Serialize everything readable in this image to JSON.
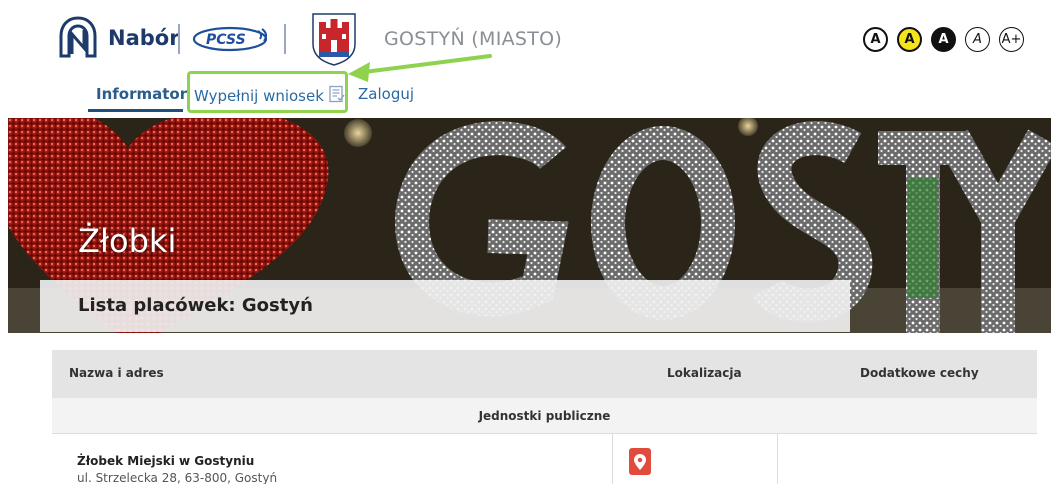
{
  "header": {
    "brand": "Nabór",
    "city": "GOSTYŃ (MIASTO)",
    "accessibility": [
      "A",
      "A",
      "A",
      "A",
      "A+"
    ]
  },
  "nav": {
    "items": [
      {
        "label": "Informator",
        "active": true
      },
      {
        "label": "Wypełnij wniosek",
        "icon": "form-document-icon"
      },
      {
        "label": "Zaloguj"
      }
    ]
  },
  "hero": {
    "title": "Żłobki",
    "subtitle": "Lista placówek: Gostyń"
  },
  "table": {
    "headers": {
      "name": "Nazwa i adres",
      "location": "Lokalizacja",
      "features": "Dodatkowe cechy"
    },
    "group": "Jednostki publiczne",
    "rows": [
      {
        "name": "Żłobek Miejski w Gostyniu",
        "address": "ul. Strzelecka 28, 63-800, Gostyń",
        "location_icon": "map-pin-icon"
      }
    ]
  },
  "colors": {
    "brand_navy": "#1e3a6b",
    "link_blue": "#2a6aa3",
    "highlight_green": "#8ed24e",
    "pin_red": "#e04b3c",
    "contrast_yellow": "#f5e31b"
  }
}
